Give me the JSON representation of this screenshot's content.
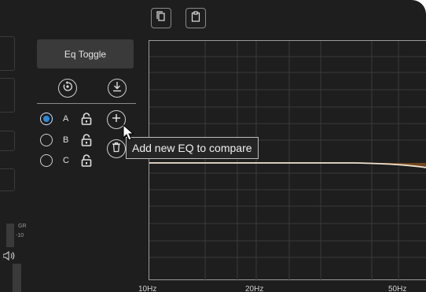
{
  "toolbar": {
    "copy_icon": "copy-icon",
    "paste_icon": "clipboard-icon"
  },
  "left_panel": {
    "gr_label": "GR",
    "meter_value": "-10",
    "speaker_icon": "speaker-icon"
  },
  "eq_panel": {
    "toggle_label": "Eq Toggle",
    "reset_icon": "reset-icon",
    "download_icon": "download-icon",
    "presets": [
      {
        "label": "A",
        "selected": true,
        "lock_icon": "unlock-icon"
      },
      {
        "label": "B",
        "selected": false,
        "lock_icon": "unlock-icon"
      },
      {
        "label": "C",
        "selected": false,
        "lock_icon": "unlock-icon"
      }
    ],
    "add_icon": "plus-icon",
    "delete_icon": "trash-icon"
  },
  "tooltip": {
    "text": "Add new EQ to compare"
  },
  "graph": {
    "freq_labels": [
      "10Hz",
      "20Hz",
      "50Hz"
    ],
    "curve_color": "#f2e3cf",
    "fill_color": "#7a4a1c"
  },
  "colors": {
    "background": "#1e1e1e",
    "accent": "#2d88d8"
  }
}
